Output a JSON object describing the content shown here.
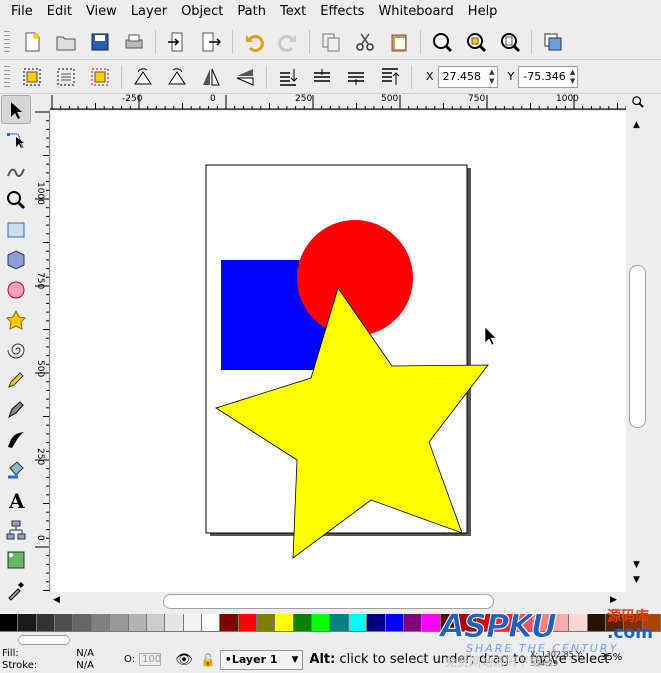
{
  "menu": [
    "File",
    "Edit",
    "View",
    "Layer",
    "Object",
    "Path",
    "Text",
    "Effects",
    "Whiteboard",
    "Help"
  ],
  "controls": {
    "x_label": "X",
    "x_value": "27.458",
    "y_label": "Y",
    "y_value": "-75.346"
  },
  "ruler": {
    "h_labels": [
      "-250",
      "0",
      "250",
      "500",
      "750",
      "1000"
    ],
    "v_labels": [
      "1000",
      "750",
      "500",
      "250",
      "0"
    ]
  },
  "palette": [
    "#000000",
    "#1a1a1a",
    "#333333",
    "#4d4d4d",
    "#666666",
    "#808080",
    "#999999",
    "#b3b3b3",
    "#cccccc",
    "#e6e6e6",
    "#f2f2f2",
    "#ffffff",
    "#800000",
    "#ff0000",
    "#808000",
    "#ffff00",
    "#008000",
    "#00ff00",
    "#008080",
    "#00ffff",
    "#000080",
    "#0000ff",
    "#800080",
    "#ff00ff",
    "#550000",
    "#aa0000",
    "#d40000",
    "#ff2a2a",
    "#ff5555",
    "#ff8080",
    "#ffaaaa",
    "#ffd5d5",
    "#2b1100",
    "#552200",
    "#803300",
    "#aa4400"
  ],
  "status": {
    "fill_label": "Fill:",
    "fill_value": "N/A",
    "stroke_label": "Stroke:",
    "stroke_value": "N/A",
    "opacity_label": "O:",
    "opacity_value": "100",
    "layer": "•Layer 1",
    "message_key": "Alt:",
    "message": " click to select under; drag to move selected",
    "coords": "X: 1302.85  Y: 334.29",
    "zoom": "35%"
  },
  "watermark": {
    "brand": "ASPKU",
    "domain": ".com",
    "cn": "源码库",
    "slogan": "SHARE THE CENTURY",
    "sub": "免费网站源码下载站！"
  },
  "colors": {
    "blue_rect": "#0000ff",
    "red_circle": "#ff0000",
    "yellow_star": "#ffff00"
  }
}
